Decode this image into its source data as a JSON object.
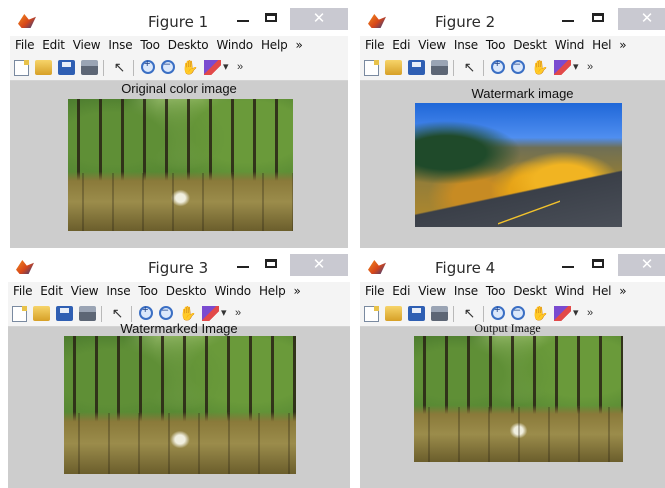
{
  "figures": [
    {
      "window_title": "Figure 1",
      "menu": [
        "File",
        "Edit",
        "View",
        "Inse",
        "Too",
        "Deskto",
        "Windo",
        "Help"
      ],
      "menu_overflow": "»",
      "toolbar_overflow": "»",
      "image_title": "Original color image",
      "image_kind": "tree-lined road photo"
    },
    {
      "window_title": "Figure 2",
      "menu": [
        "File",
        "Edi",
        "View",
        "Inse",
        "Too",
        "Deskt",
        "Wind",
        "Hel"
      ],
      "menu_overflow": "»",
      "toolbar_overflow": "»",
      "image_title": "Watermark image",
      "image_kind": "mountain road with autumn aspens"
    },
    {
      "window_title": "Figure 3",
      "menu": [
        "File",
        "Edit",
        "View",
        "Inse",
        "Too",
        "Deskto",
        "Windo",
        "Help"
      ],
      "menu_overflow": "»",
      "toolbar_overflow": "»",
      "image_title": "Watermarked Image",
      "image_kind": "tree-lined road photo"
    },
    {
      "window_title": "Figure 4",
      "menu": [
        "File",
        "Edi",
        "View",
        "Inse",
        "Too",
        "Deskt",
        "Wind",
        "Hel"
      ],
      "menu_overflow": "»",
      "toolbar_overflow": "»",
      "image_title": "Output Image",
      "image_kind": "tree-lined road photo"
    }
  ],
  "window_controls": {
    "minimize": "—",
    "maximize": "□",
    "close": "✕"
  },
  "icons": [
    "new-file-icon",
    "open-folder-icon",
    "save-icon",
    "print-icon",
    "select-arrow-icon",
    "zoom-in-icon",
    "zoom-out-icon",
    "pan-hand-icon",
    "brush-icon",
    "dropdown-icon"
  ],
  "colors": {
    "window_bg": "#cfcfcf",
    "title_bar": "#ffffff",
    "close_button": "#c9c9d1",
    "menu_bar": "#f4f4f4"
  }
}
